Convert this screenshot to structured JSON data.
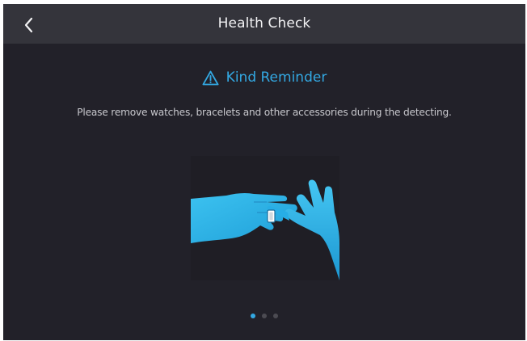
{
  "header": {
    "title": "Health Check",
    "back_icon": "chevron-left-icon"
  },
  "reminder": {
    "icon": "warning-triangle-icon",
    "title": "Kind Reminder",
    "message": "Please remove watches, bracelets and other accessories during the detecting."
  },
  "illustration": {
    "subject": "hands-removing-ring-illustration"
  },
  "pagination": {
    "total": 3,
    "current": 1
  },
  "colors": {
    "accent": "#33a8e2",
    "background": "#222129",
    "header_background": "#34343b",
    "hand": "#2fb6ea"
  }
}
